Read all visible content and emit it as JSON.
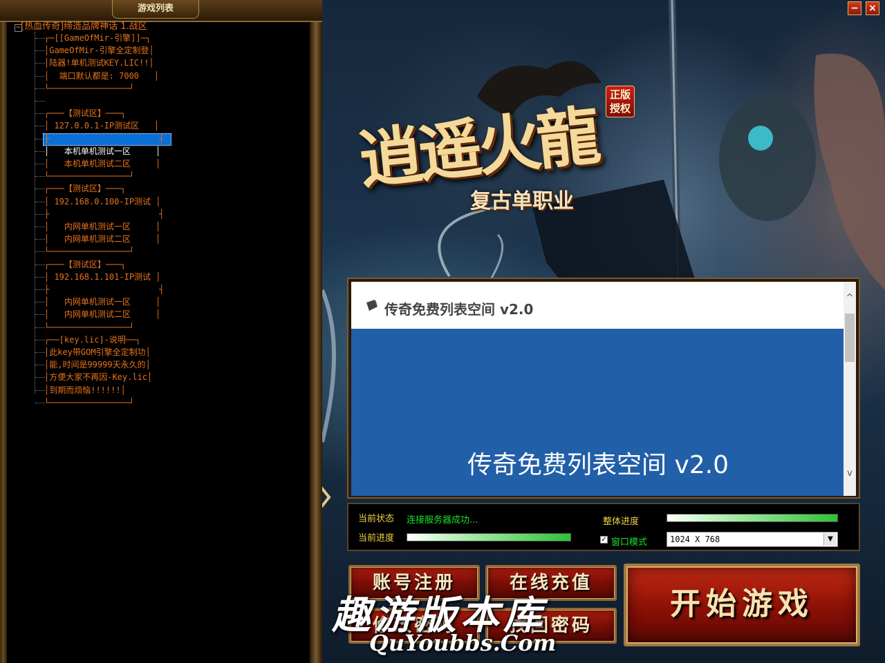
{
  "server_list": {
    "panel_title": "游戏列表",
    "expander": "−",
    "root": "[热血传奇]缔造品牌神话 1.战区",
    "lines": [
      "┌─[[GameOfMir-引擎]]─┐",
      "│GameOfMir-引擎全定制登│",
      "│陆器!单机测试KEY.LIC!!│",
      "│  端口默认都是: 7000   │",
      "└────────────────┘",
      "",
      "┌───【测试区】───┐",
      "│ 127.0.0.1-IP测试区   │",
      "├                      ┤",
      "│   本机单机测试一区     │",
      "│   本机单机测试二区     │",
      "└────────────────┘",
      "┌───【测试区】───┐",
      "│ 192.168.0.100-IP测试 │",
      "├                      ┤",
      "│   内网单机测试一区     │",
      "│   内网单机测试二区     │",
      "└────────────────┘",
      "┌───【测试区】───┐",
      "│ 192.168.1.101-IP测试 │",
      "├                      ┤",
      "│   内网单机测试一区     │",
      "│   内网单机测试二区     │",
      "└────────────────┘",
      "┌──[key.lic]-说明──┐",
      "│此key带GOM引擎全定制功│",
      "│能,时间是99999天永久的│",
      "│方便大家不再因-Key.lic│",
      "│到期而烦恼!!!!!!│",
      "└────────────────┘"
    ],
    "selected_item": "本机单机测试一区"
  },
  "window_controls": {
    "minimize": "−",
    "close": "×"
  },
  "logo": {
    "title": "逍遥火龍",
    "subtitle": "复古单职业",
    "badge_line1": "正版",
    "badge_line2": "授权"
  },
  "notice": {
    "header_title": "传奇免费列表空间 v2.0",
    "body_text": "传奇免费列表空间 v2.0",
    "scroll_up": "^",
    "scroll_down": "v"
  },
  "status": {
    "current_status_label": "当前状态",
    "current_status_value": "连接服务器成功...",
    "current_progress_label": "当前进度",
    "current_progress": 1.0,
    "overall_progress_label": "整体进度",
    "overall_progress": 1.0,
    "window_mode_label": "窗口模式",
    "window_mode_checked": true,
    "resolution": "1024 X 768"
  },
  "buttons": {
    "register": "账号注册",
    "recharge": "在线充值",
    "change_password": "修改密码",
    "find_password": "找回密码",
    "start_game": "开始游戏"
  },
  "watermark": {
    "cn": "趣游版本库",
    "en": "QuYoubbs.Com"
  },
  "colors": {
    "tree_text": "#e8731b",
    "status_label": "#f0d14a",
    "status_value": "#1ae12a",
    "notice_blue": "#215fa8",
    "button_red": "#8a1006"
  }
}
